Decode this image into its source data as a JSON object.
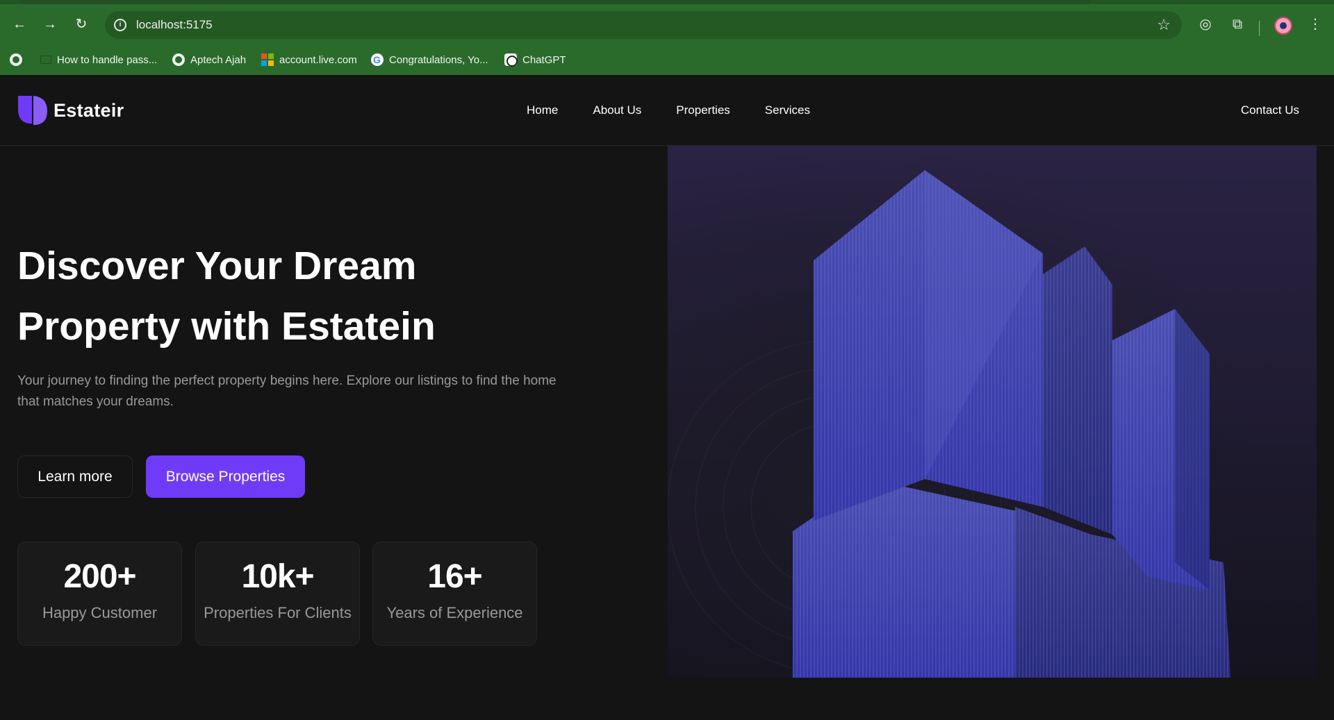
{
  "browser": {
    "url": "localhost:5175",
    "bookmarks": [
      {
        "label": "How to handle pass...",
        "icon": "folder-icon"
      },
      {
        "label": "Aptech Ajah",
        "icon": "globe-icon"
      },
      {
        "label": "account.live.com",
        "icon": "microsoft-icon"
      },
      {
        "label": "Congratulations, Yo...",
        "icon": "google-icon"
      },
      {
        "label": "ChatGPT",
        "icon": "chatgpt-icon"
      }
    ]
  },
  "site": {
    "brand": "Estateir",
    "nav": [
      "Home",
      "About Us",
      "Properties",
      "Services"
    ],
    "contact": "Contact Us",
    "accent": "#703bf7"
  },
  "hero": {
    "title_line1": "Discover Your Dream",
    "title_line2": "Property with Estatein",
    "subtitle": "Your journey to finding the perfect property begins here. Explore our listings to find the home that matches your dreams.",
    "learn_more": "Learn more",
    "browse": "Browse Properties"
  },
  "stats": [
    {
      "value": "200+",
      "label": "Happy Customer"
    },
    {
      "value": "10k+",
      "label": "Properties For Clients"
    },
    {
      "value": "16+",
      "label": "Years of Experience"
    }
  ]
}
